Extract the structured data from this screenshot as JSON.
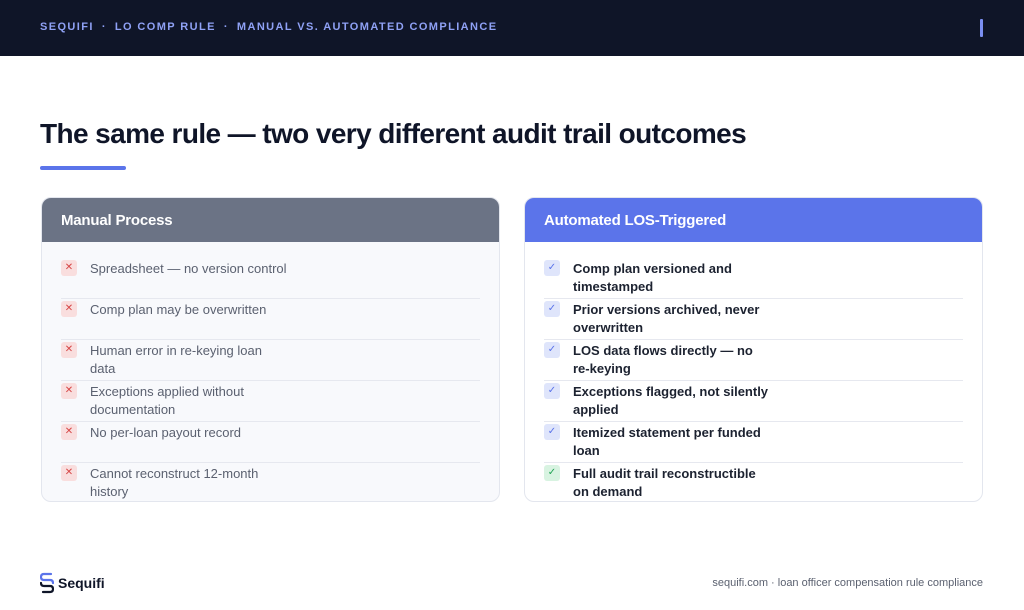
{
  "header": {
    "breadcrumb": [
      "SEQUIFI",
      "LO COMP RULE",
      "MANUAL VS. AUTOMATED COMPLIANCE"
    ],
    "separator": "·"
  },
  "title": "The same rule — two very different audit trail outcomes",
  "colors": {
    "topbar": "#0f1528",
    "accent": "#5b74ea",
    "manual_header": "#6b7385",
    "x_mark": "#d64545",
    "check_mark": "#5b74ea",
    "check_green": "#23a455"
  },
  "manual": {
    "heading": "Manual Process",
    "items": [
      {
        "icon": "x-icon",
        "text": "Spreadsheet — no version control"
      },
      {
        "icon": "x-icon",
        "text": "Comp plan may be overwritten"
      },
      {
        "icon": "x-icon",
        "text": "Human error in re-keying loan data"
      },
      {
        "icon": "x-icon",
        "text": "Exceptions applied without documentation"
      },
      {
        "icon": "x-icon",
        "text": "No per-loan payout record"
      },
      {
        "icon": "x-icon",
        "text": "Cannot reconstruct 12-month history"
      }
    ]
  },
  "automated": {
    "heading": "Automated LOS-Triggered",
    "items": [
      {
        "icon": "check-icon",
        "text": "Comp plan versioned and timestamped"
      },
      {
        "icon": "check-icon",
        "text": "Prior versions archived, never overwritten"
      },
      {
        "icon": "check-icon",
        "text": "LOS data flows directly — no re-keying"
      },
      {
        "icon": "check-icon",
        "text": "Exceptions flagged, not silently applied"
      },
      {
        "icon": "check-icon",
        "text": "Itemized statement per funded loan"
      },
      {
        "icon": "check-green-icon",
        "text": "Full audit trail reconstructible on demand"
      }
    ]
  },
  "footer": {
    "logo_text": "Sequifi",
    "right_text": "sequifi.com · loan officer compensation rule compliance"
  }
}
